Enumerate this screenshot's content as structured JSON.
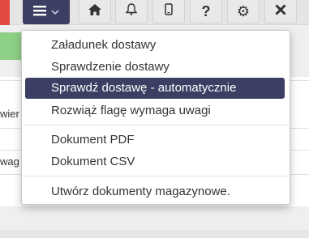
{
  "toolbar": {
    "menu_icon": "hamburger-icon",
    "buttons": [
      {
        "icon": "home-icon",
        "glyph": "⌂"
      },
      {
        "icon": "bell-icon",
        "glyph": "🔔"
      },
      {
        "icon": "phone-icon",
        "glyph": "▯"
      },
      {
        "icon": "help-icon",
        "glyph": "?"
      },
      {
        "icon": "gear-icon",
        "glyph": "⚙"
      },
      {
        "icon": "close-icon",
        "glyph": "✕"
      }
    ]
  },
  "background": {
    "row1_text": "wier",
    "row2_text": "wag"
  },
  "menu": {
    "items": [
      {
        "label": "Załadunek dostawy"
      },
      {
        "label": "Sprawdzenie dostawy"
      },
      {
        "label": "Sprawdź dostawę - automatycznie"
      },
      {
        "label": "Rozwiąż flagę wymaga uwagi"
      },
      {
        "label": "Dokument PDF"
      },
      {
        "label": "Dokument CSV"
      },
      {
        "label": "Utwórz dokumenty magazynowe."
      }
    ]
  },
  "colors": {
    "accent": "#3c3f63",
    "danger": "#e24b42",
    "success": "#8ecf86"
  }
}
